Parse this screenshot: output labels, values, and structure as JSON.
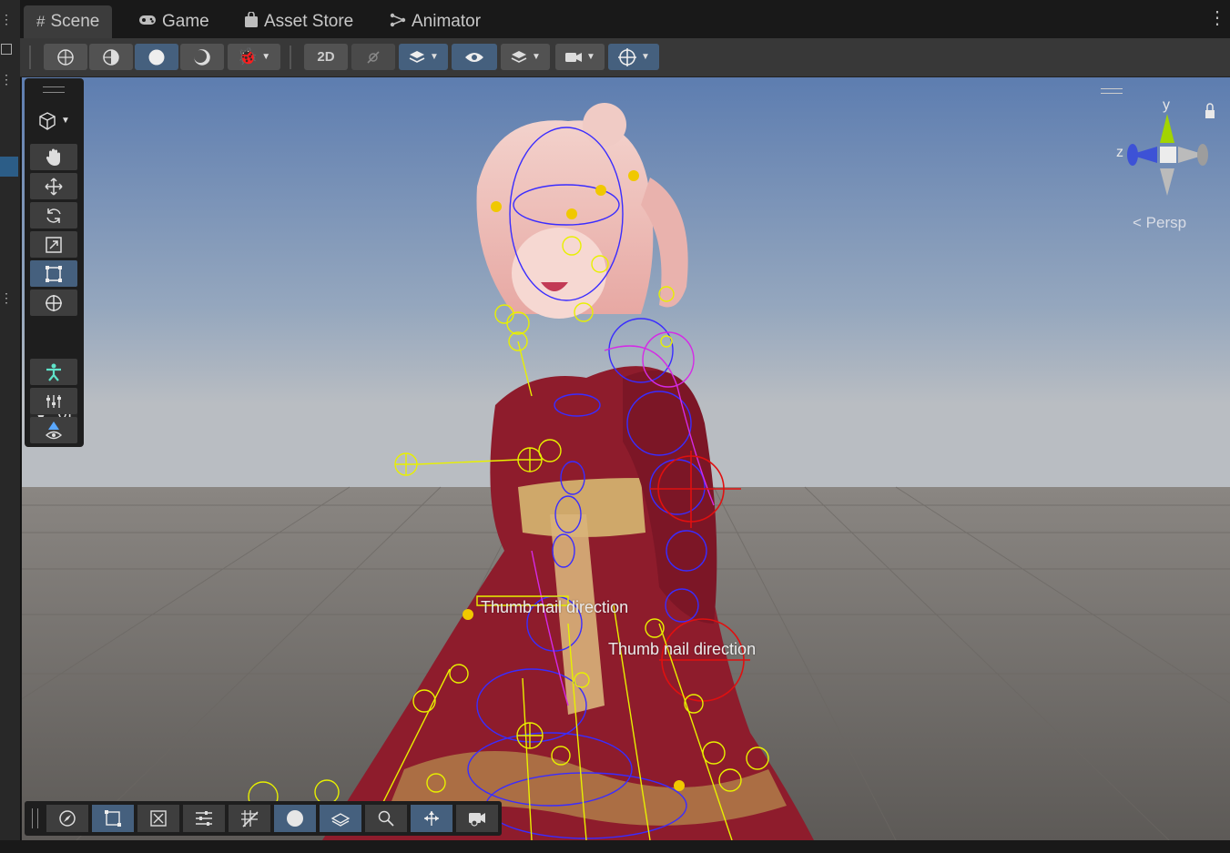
{
  "tabs": [
    {
      "label": "Scene",
      "glyph": "#",
      "active": true
    },
    {
      "label": "Game",
      "glyph": "🎮",
      "active": false
    },
    {
      "label": "Asset Store",
      "glyph": "🛍",
      "active": false
    },
    {
      "label": "Animator",
      "glyph": "⤳",
      "active": false
    }
  ],
  "tools_panel": {
    "vi_label": "VI"
  },
  "gizmo": {
    "axis_y": "y",
    "axis_z": "z",
    "projection": "Persp"
  },
  "scene_labels": {
    "thumb_nail_left": "Thumb nail direction",
    "thumb_nail_right": "Thumb nail direction"
  },
  "colors": {
    "accent": "#45607e",
    "toolbar_bg": "#383838",
    "sky_top": "#5d7db0",
    "ground": "#5d5a57",
    "bone_yellow": "#e8f000",
    "bone_blue": "#3a2cff",
    "bone_magenta": "#d52ae6",
    "bone_red": "#e01010",
    "dress_red": "#8e1c2c"
  }
}
